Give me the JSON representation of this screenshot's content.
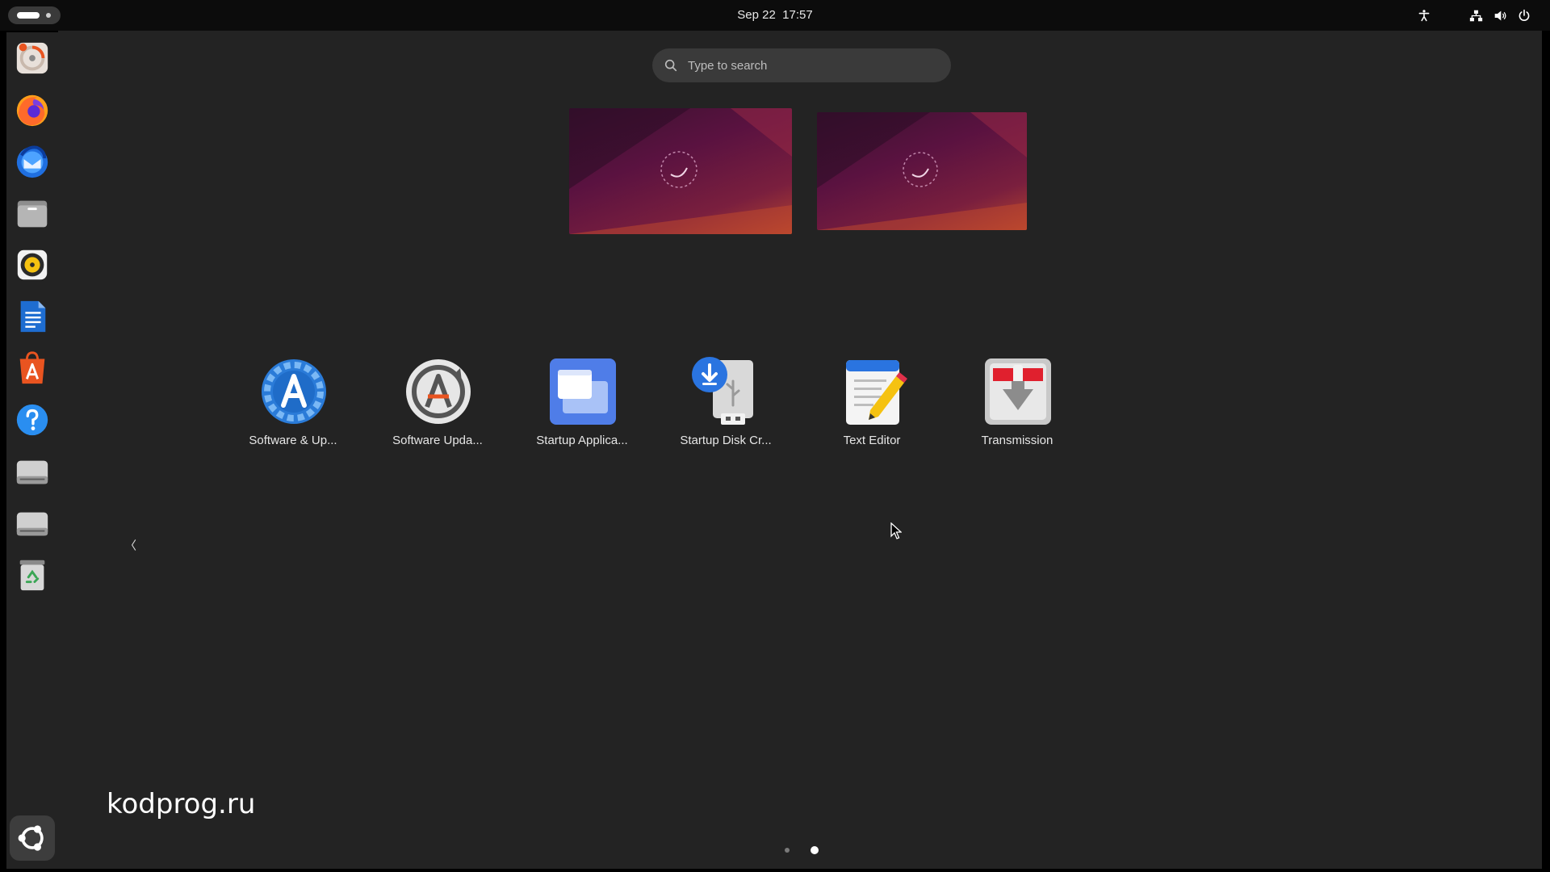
{
  "topbar": {
    "date": "Sep 22",
    "time": "17:57"
  },
  "dock": {
    "items": [
      "disk-usage",
      "firefox",
      "thunderbird",
      "files",
      "rhythmbox",
      "libreoffice-writer",
      "app-center",
      "help",
      "drive",
      "drive",
      "trash"
    ],
    "show_apps": "show-apps"
  },
  "search": {
    "placeholder": "Type to search"
  },
  "apps": [
    {
      "label": "Software & Up...",
      "icon": "software-properties-icon"
    },
    {
      "label": "Software Upda...",
      "icon": "software-updater-icon"
    },
    {
      "label": "Startup Applica...",
      "icon": "startup-applications-icon"
    },
    {
      "label": "Startup Disk Cr...",
      "icon": "startup-disk-creator-icon"
    },
    {
      "label": "Text Editor",
      "icon": "text-editor-icon"
    },
    {
      "label": "Transmission",
      "icon": "transmission-icon"
    }
  ],
  "pager": {
    "pages": 2,
    "current": 2
  },
  "watermark": "kodprog.ru",
  "colors": {
    "accent": "#e95420",
    "panel": "#0c0c0c",
    "overview": "#232323"
  }
}
